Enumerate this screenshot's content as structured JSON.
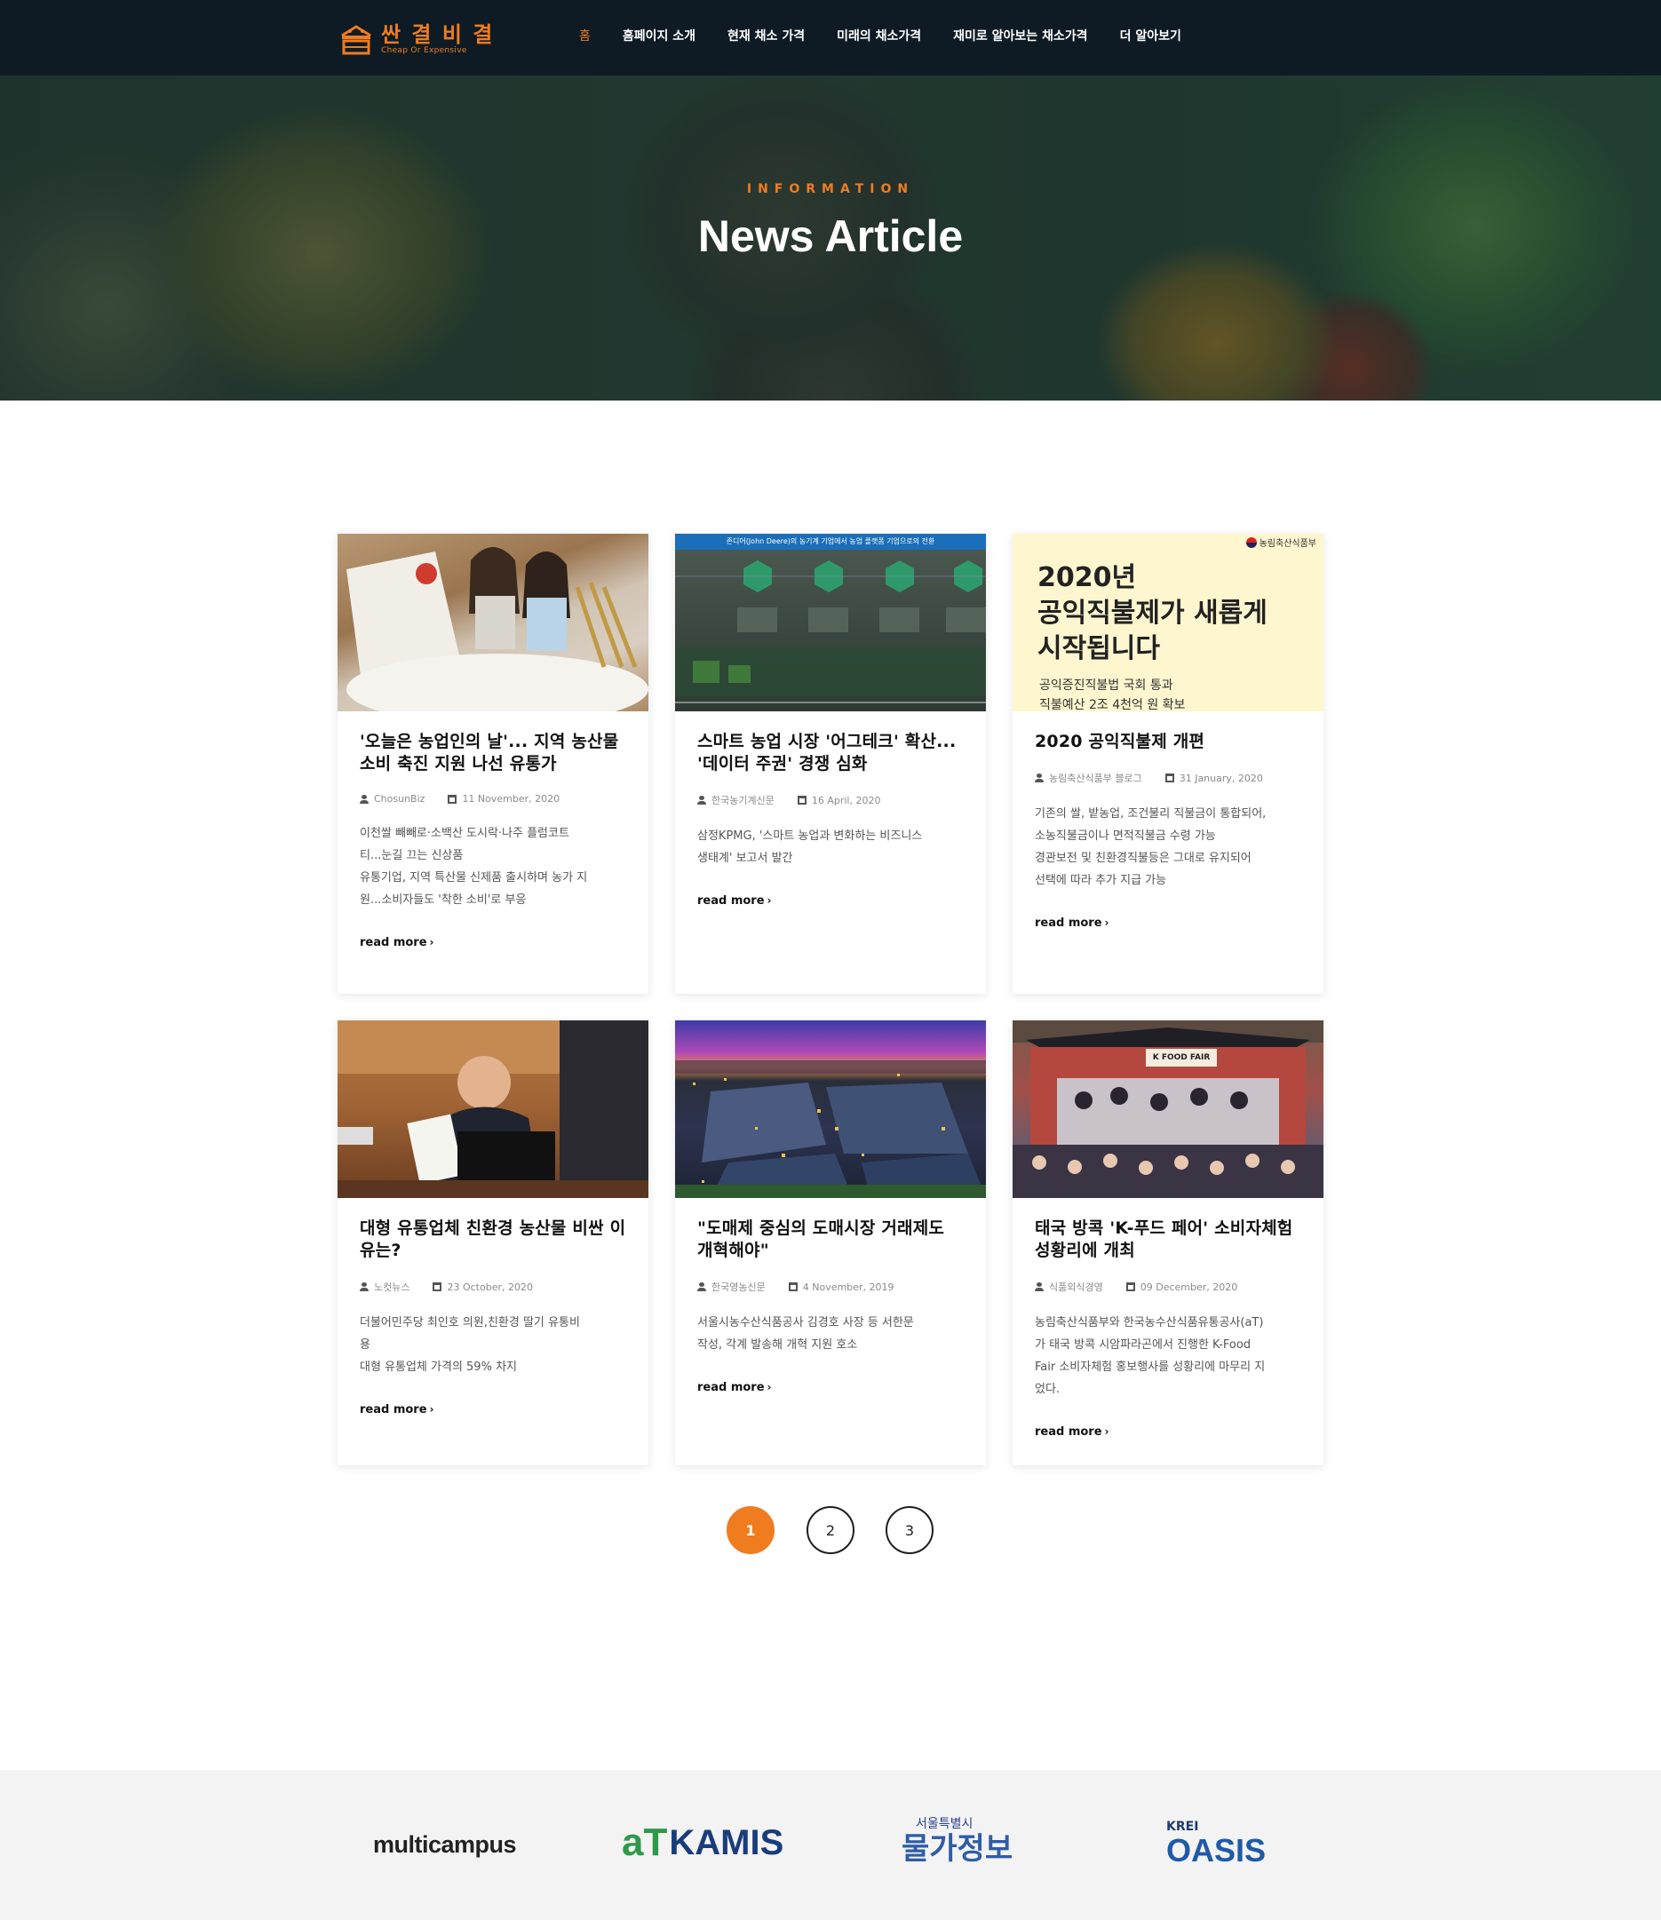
{
  "brand": {
    "title": "싼 결 비 결",
    "subtitle": "Cheap Or Expensive",
    "accent": "#f07c20",
    "header_bg": "#0e1b24"
  },
  "nav": [
    {
      "label": "홈",
      "active": true
    },
    {
      "label": "홈페이지 소개"
    },
    {
      "label": "현재 채소 가격"
    },
    {
      "label": "미래의 채소가격"
    },
    {
      "label": "재미로 알아보는 채소가격"
    },
    {
      "label": "더 알아보기"
    }
  ],
  "hero": {
    "kicker": "INFORMATION",
    "title": "News Article"
  },
  "articles": [
    {
      "title": "'오늘은 농업인의 날'... 지역 농산물 소비 축진 지원 나선 유통가",
      "source": "ChosunBiz",
      "date": "11 November, 2020",
      "excerpt": "이천쌀 빼빼로·소백산 도시락·나주 플럼코트\n티...눈길 끄는 신상품\n유통기업, 지역 특산물 신제품 출시하며 농가 지\n원...소비자들도 '착한 소비'로 부응",
      "read_more": "read more",
      "image_icon": "rice-harvest-photo"
    },
    {
      "title": "스마트 농업 시장 '어그테크' 확산... '데이터 주권' 경쟁 심화",
      "source": "한국농기계신문",
      "date": "16 April, 2020",
      "excerpt": "삼정KPMG, '스마트 농업과 변화하는 비즈니스\n생태계' 보고서 발간",
      "read_more": "read more",
      "image_caption": "존디어(John Deere)의 농기계 기업에서 농업 플랫폼 기업으로의 전환",
      "image_icon": "agtech-infographic"
    },
    {
      "title": "2020 공익직불제 개편",
      "source": "농림축산식품부 블로그",
      "date": "31 January, 2020",
      "excerpt": "기존의 쌀, 밭농업, 조건불리 직불금이 통합되어,\n소농직불금이나 면적직불금 수령 가능\n경관보전 및 친환경직불등은 그대로 유지되어\n선택에 따라 추가 지급 가능",
      "read_more": "read more",
      "image_org": "농림축산식품부",
      "image_headline_1": "2020년",
      "image_headline_2": "공익직불제가 새롭게",
      "image_headline_3": "시작됩니다",
      "image_sub_1": "공익증진직불법 국회 통과",
      "image_sub_2": "직불예산 2조 4천억 원 확보"
    },
    {
      "title": "대형 유통업체 친환경 농산물 비싼 이유는?",
      "source": "노컷뉴스",
      "date": "23 October, 2020",
      "excerpt": "더불어민주당 최인호 의원,친환경 딸기 유통비\n용\n대형 유통업체 가격의 59% 차지",
      "read_more": "read more",
      "image_icon": "press-conference-photo"
    },
    {
      "title": "\"도매제 중심의 도매시장 거래제도 개혁해야\"",
      "source": "한국영농신문",
      "date": "4 November, 2019",
      "excerpt": "서울시농수산식품공사 김경호 사장 등 서한문\n작성, 각계 발송해 개혁 지원 호소",
      "read_more": "read more",
      "image_icon": "wholesale-market-night-photo"
    },
    {
      "title": "태국 방콕 'K-푸드 페어' 소비자체험 성황리에 개최",
      "source": "식품외식경영",
      "date": "09 December, 2020",
      "excerpt": "농림축산식품부와 한국농수산식품유통공사(aT)\n가 태국 방콕 시암파라곤에서 진행한 K-Food\nFair 소비자체험 홍보행사를 성황리에 마무리 지\n었다.",
      "read_more": "read more",
      "image_sign": "K FOOD FAIR",
      "image_icon": "kfood-fair-photo"
    }
  ],
  "pagination": {
    "pages": [
      "1",
      "2",
      "3"
    ],
    "current": "1"
  },
  "partners": [
    {
      "name": "multicampus"
    },
    {
      "name_a": "aT",
      "name_b": "KAMIS"
    },
    {
      "top": "서울특별시",
      "main": "물가정보"
    },
    {
      "top": "KREI",
      "main": "OASIS"
    }
  ]
}
